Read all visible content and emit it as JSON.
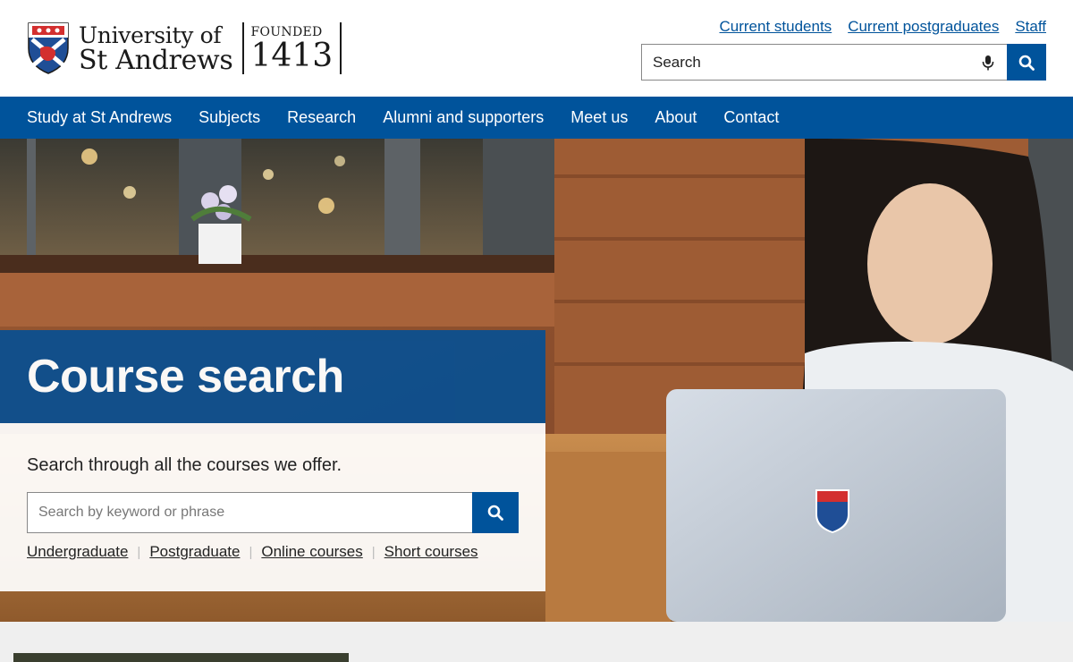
{
  "header": {
    "logo": {
      "line1": "University of",
      "line2": "St Andrews",
      "founded_label": "FOUNDED",
      "founded_year": "1413"
    },
    "utility_links": [
      "Current students",
      "Current postgraduates",
      "Staff"
    ],
    "search": {
      "placeholder": "Search"
    }
  },
  "nav": {
    "items": [
      "Study at St Andrews",
      "Subjects",
      "Research",
      "Alumni and supporters",
      "Meet us",
      "About",
      "Contact"
    ]
  },
  "hero": {
    "title": "Course search",
    "intro": "Search through all the courses we offer.",
    "search_placeholder": "Search by keyword or phrase",
    "links": [
      "Undergraduate",
      "Postgraduate",
      "Online courses",
      "Short courses"
    ]
  },
  "colors": {
    "brand_blue": "#00539b",
    "title_box_blue": "#0d4f8e"
  },
  "icons": {
    "search": "search-icon",
    "mic": "microphone-icon",
    "crest": "university-crest-icon"
  }
}
